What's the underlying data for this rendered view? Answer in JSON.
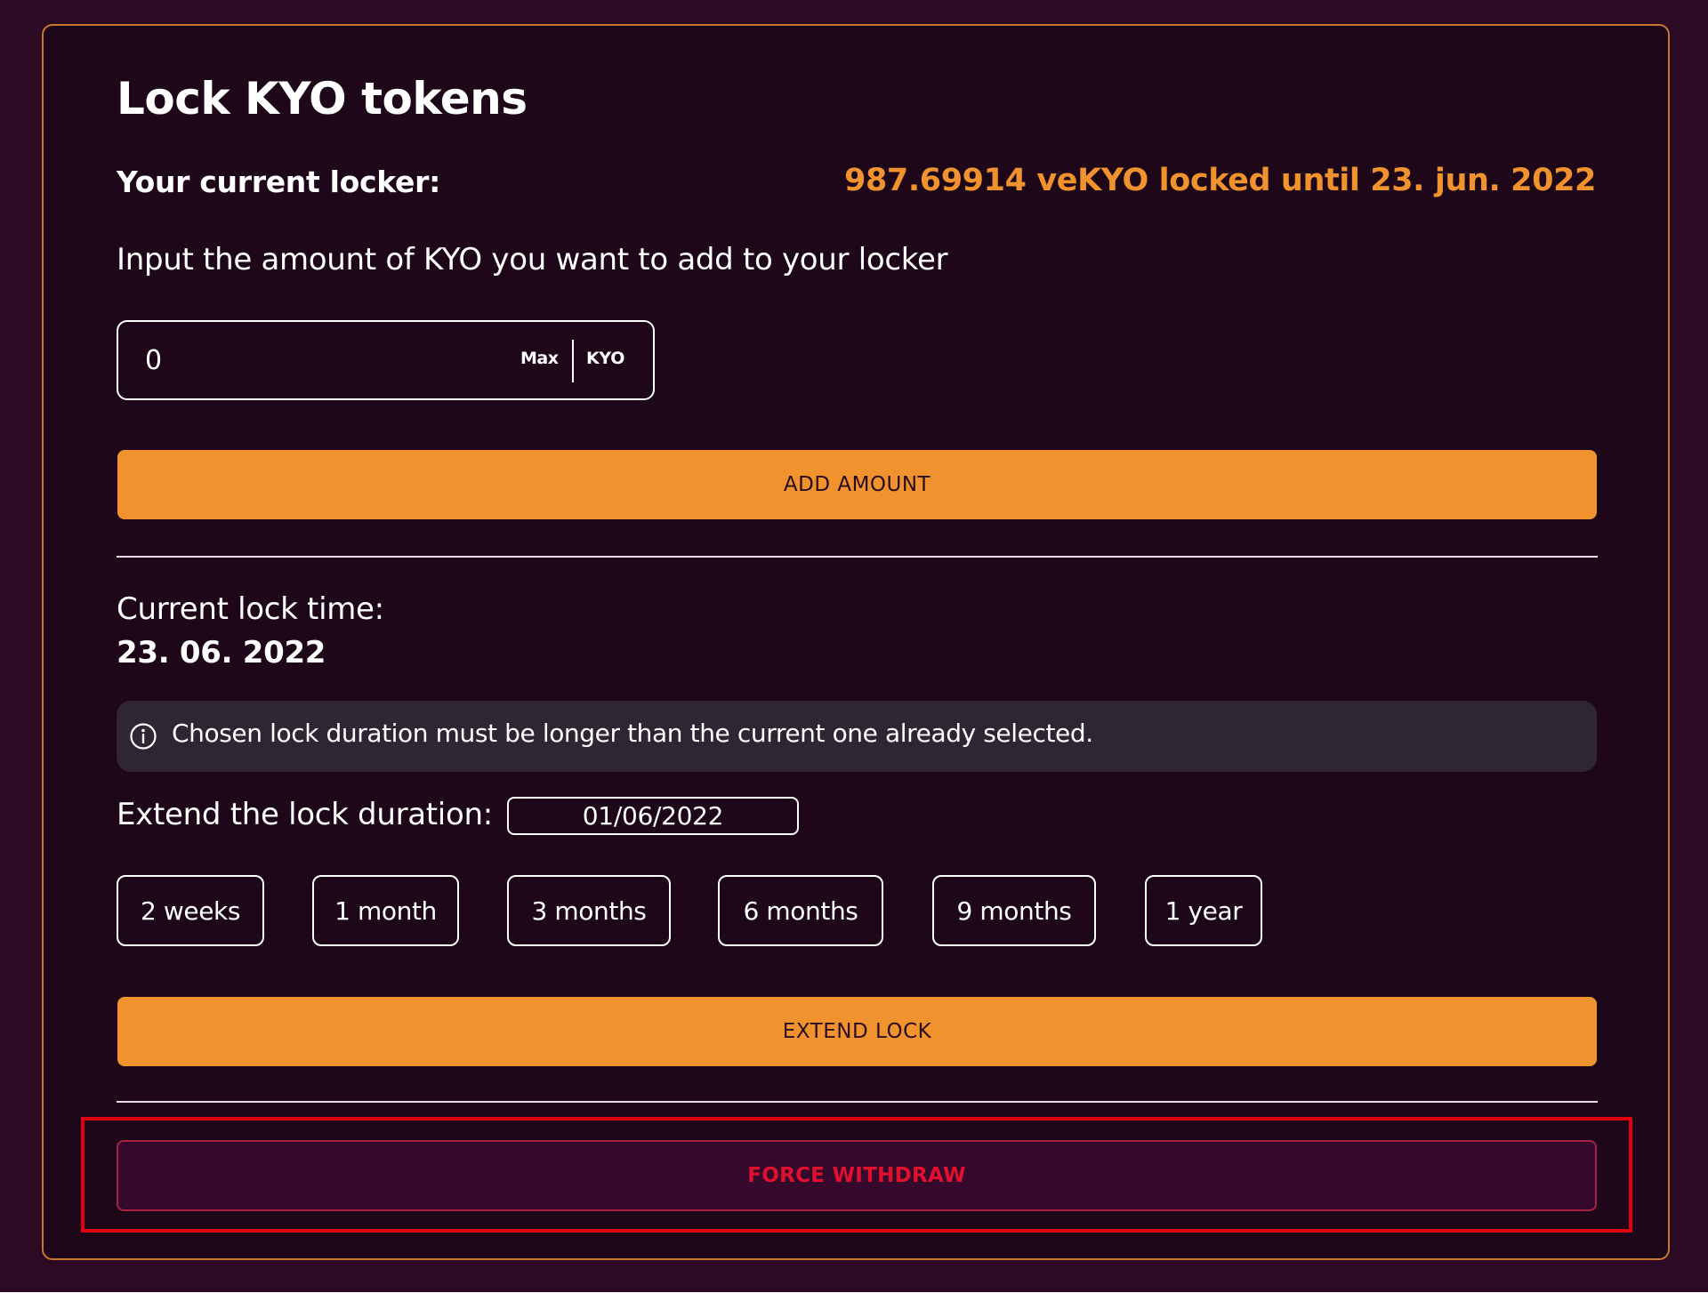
{
  "panel": {
    "title": "Lock KYO tokens",
    "locker_label": "Your current locker:",
    "locker_value": "987.69914 veKYO locked until 23. jun. 2022"
  },
  "add_amount": {
    "input_label": "Input the amount of KYO you want to add to your locker",
    "amount_value": "0",
    "max_label": "Max",
    "unit_label": "KYO",
    "button_label": "ADD AMOUNT"
  },
  "lock_time": {
    "label": "Current lock time:",
    "value": "23. 06. 2022"
  },
  "info": {
    "icon": "info-circle-icon",
    "text": "Chosen lock duration must be longer than the current one already selected."
  },
  "extend": {
    "label": "Extend the lock duration:",
    "date_value": "01/06/2022",
    "durations": [
      "2 weeks",
      "1 month",
      "3 months",
      "6 months",
      "9 months",
      "1 year"
    ],
    "button_label": "EXTEND LOCK"
  },
  "force_withdraw": {
    "button_label": "FORCE WITHDRAW"
  },
  "colors": {
    "background": "#2d0a24",
    "panel": "#1d0718",
    "panel_border": "#c8782e",
    "accent": "#f0932e",
    "locker_value": "#f0922d",
    "info_bg": "#2e2633",
    "danger": "#e0102e",
    "highlight": "#e0000f"
  }
}
